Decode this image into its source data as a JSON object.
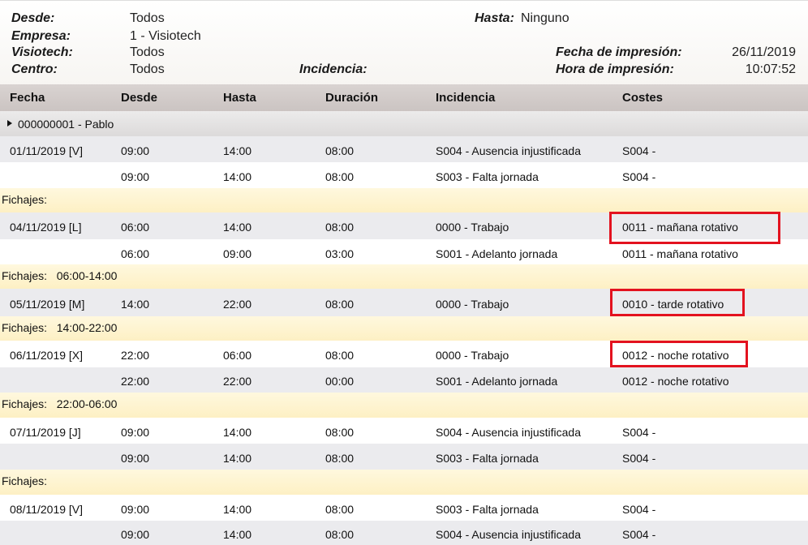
{
  "header": {
    "desde_label": "Desde:",
    "desde_value": "Todos",
    "empresa_label": "Empresa:",
    "empresa_value": "1 - Visiotech",
    "visiotech_label": "Visiotech:",
    "visiotech_value": "Todos",
    "centro_label": "Centro:",
    "centro_value": "Todos",
    "incidencia_label": "Incidencia:",
    "hasta_label": "Hasta:",
    "hasta_value": "Ninguno",
    "fecha_imp_label": "Fecha de impresión:",
    "fecha_imp_value": "26/11/2019",
    "hora_imp_label": "Hora de impresión:",
    "hora_imp_value": "10:07:52"
  },
  "columns": [
    "Fecha",
    "Desde",
    "Hasta",
    "Duración",
    "Incidencia",
    "Costes"
  ],
  "group": "000000001 - Pablo",
  "rows": [
    {
      "fecha": "01/11/2019 [V]",
      "desde": "09:00",
      "hasta": "14:00",
      "duracion": "08:00",
      "incidencia": "S004 - Ausencia injustificada",
      "costes": "S004 -"
    },
    {
      "fecha": "",
      "desde": "09:00",
      "hasta": "14:00",
      "duracion": "08:00",
      "incidencia": "S003 - Falta jornada",
      "costes": "S004 -"
    },
    {
      "fichajes": "Fichajes:"
    },
    {
      "fecha": "04/11/2019 [L]",
      "desde": "06:00",
      "hasta": "14:00",
      "duracion": "08:00",
      "incidencia": "0000 - Trabajo",
      "costes": "0011 - mañana rotativo"
    },
    {
      "fecha": "",
      "desde": "06:00",
      "hasta": "09:00",
      "duracion": "03:00",
      "incidencia": "S001 - Adelanto jornada",
      "costes": "0011 - mañana rotativo"
    },
    {
      "fichajes": "Fichajes:   06:00-14:00"
    },
    {
      "fecha": "05/11/2019 [M]",
      "desde": "14:00",
      "hasta": "22:00",
      "duracion": "08:00",
      "incidencia": "0000 - Trabajo",
      "costes": "0010 - tarde rotativo"
    },
    {
      "fichajes": "Fichajes:   14:00-22:00"
    },
    {
      "fecha": "06/11/2019 [X]",
      "desde": "22:00",
      "hasta": "06:00",
      "duracion": "08:00",
      "incidencia": "0000 - Trabajo",
      "costes": "0012 - noche rotativo"
    },
    {
      "fecha": "",
      "desde": "22:00",
      "hasta": "22:00",
      "duracion": "00:00",
      "incidencia": "S001 - Adelanto jornada",
      "costes": "0012 - noche rotativo"
    },
    {
      "fichajes": "Fichajes:   22:00-06:00"
    },
    {
      "fecha": "07/11/2019 [J]",
      "desde": "09:00",
      "hasta": "14:00",
      "duracion": "08:00",
      "incidencia": "S004 - Ausencia injustificada",
      "costes": "S004 -"
    },
    {
      "fecha": "",
      "desde": "09:00",
      "hasta": "14:00",
      "duracion": "08:00",
      "incidencia": "S003 - Falta jornada",
      "costes": "S004 -"
    },
    {
      "fichajes": "Fichajes:"
    },
    {
      "fecha": "08/11/2019 [V]",
      "desde": "09:00",
      "hasta": "14:00",
      "duracion": "08:00",
      "incidencia": "S003 - Falta jornada",
      "costes": "S004 -"
    },
    {
      "fecha": "",
      "desde": "09:00",
      "hasta": "14:00",
      "duracion": "08:00",
      "incidencia": "S004 - Ausencia injustificada",
      "costes": "S004 -"
    }
  ],
  "highlight_color": "#e3121f"
}
